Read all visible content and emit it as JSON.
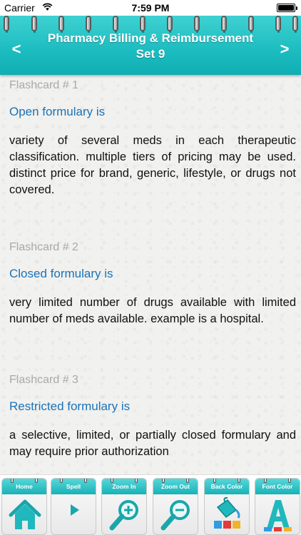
{
  "status_bar": {
    "carrier": "Carrier",
    "time": "7:59 PM"
  },
  "header": {
    "title_line1": "Pharmacy Billing & Reimbursement",
    "title_line2": "Set 9",
    "back_symbol": "<",
    "forward_symbol": ">",
    "color": "#1bbcc0"
  },
  "cards": [
    {
      "label": "Flashcard # 1",
      "question": "Open formulary is",
      "answer": "variety of several meds in each therapeutic classification. multiple tiers of pricing may be used. distinct price for brand, generic, lifestyle, or drugs not covered."
    },
    {
      "label": "Flashcard # 2",
      "question": "Closed formulary is",
      "answer": "very limited number of drugs available with limited number of meds available. example is a hospital."
    },
    {
      "label": "Flashcard # 3",
      "question": "Restricted formulary is",
      "answer": "a selective, limited, or partially closed formulary and may require prior authorization"
    }
  ],
  "toolbar": {
    "home_label": "Home",
    "spell_label": "Spell",
    "zoom_in_label": "Zoom In",
    "zoom_out_label": "Zoom Out",
    "back_color_label": "Back Color",
    "font_color_label": "Font Color",
    "icons": [
      "home-icon",
      "play-icon",
      "zoom-in-icon",
      "zoom-out-icon",
      "paint-bucket-icon",
      "font-color-icon"
    ]
  },
  "colors": {
    "accent": "#1bbcc0",
    "question_text": "#1a73b8",
    "label_text": "#a9a9a9"
  }
}
